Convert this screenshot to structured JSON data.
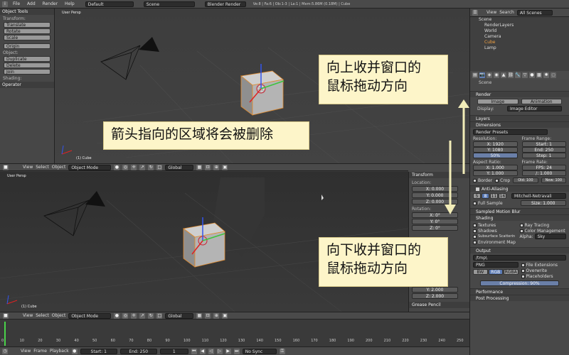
{
  "topbar": {
    "menu": [
      "File",
      "Add",
      "Render",
      "Help"
    ],
    "layout": "Default",
    "scene": "Scene",
    "engine": "Blender Render",
    "stats": "Ve:8 | Fa:6 | Ob:1-3 | La:1 | Mem:5.86M (0.18M) | Cube"
  },
  "toolshelf": {
    "header": "Object Tools",
    "transform_label": "Transform:",
    "transform_buttons": [
      "Translate",
      "Rotate",
      "Scale"
    ],
    "origin_button": "Origin",
    "object_label": "Object:",
    "object_buttons": [
      "Duplicate",
      "Delete",
      "Join"
    ],
    "shading_label": "Shading:",
    "operator_header": "Operator"
  },
  "viewport_top": {
    "label": "User Persp",
    "object_label": "(1) Cube"
  },
  "viewport_header": {
    "menu": [
      "View",
      "Select",
      "Object"
    ],
    "mode": "Object Mode",
    "orientation": "Global"
  },
  "viewport_bottom": {
    "label": "User Persp",
    "object_label": "(1) Cube"
  },
  "npanel": {
    "header": "Transform",
    "location_label": "Location:",
    "location": [
      "X: 0.000",
      "Y: 0.000",
      "Z: 0.000"
    ],
    "rotation_label": "Rotation:",
    "rotation": [
      "X: 0°",
      "Y: 0°",
      "Z: 0°"
    ],
    "dimensions": [
      "Y: 2.000",
      "Z: 2.000"
    ],
    "footer": "Grease Pencil"
  },
  "timeline": {
    "ticks": [
      "0",
      "10",
      "20",
      "30",
      "40",
      "50",
      "60",
      "70",
      "80",
      "90",
      "100",
      "110",
      "120",
      "130",
      "140",
      "150",
      "160",
      "170",
      "180",
      "190",
      "200",
      "210",
      "220",
      "230",
      "240",
      "250"
    ],
    "menu": [
      "View",
      "Frame",
      "Playback"
    ],
    "start": "Start: 1",
    "end": "End: 250",
    "current": "1",
    "sync": "No Sync"
  },
  "outliner": {
    "menu": [
      "View",
      "Search"
    ],
    "filter": "All Scenes",
    "items": [
      "Scene",
      "RenderLayers",
      "World",
      "Camera",
      "Cube",
      "Lamp"
    ]
  },
  "properties": {
    "breadcrumb": "Scene",
    "render_header": "Render",
    "render_buttons": [
      "Image",
      "Animation"
    ],
    "display_label": "Display:",
    "display_value": "Image Editor",
    "layers_header": "Layers",
    "dimensions_header": "Dimensions",
    "presets": "Render Presets",
    "resolution_label": "Resolution:",
    "res_x": "X: 1920",
    "res_y": "Y: 1080",
    "res_pct": "50%",
    "frame_range_label": "Frame Range:",
    "start": "Start: 1",
    "end": "End: 250",
    "step": "Step: 1",
    "aspect_label": "Aspect Ratio:",
    "aspect_x": "X: 1.000",
    "aspect_y": "Y: 1.000",
    "frame_rate_label": "Frame Rate:",
    "fps": "FPS: 24",
    "time": "/: 1.000",
    "border": "Border",
    "crop": "Crop",
    "old": "Old: 100",
    "new": "New: 100",
    "aa_header": "Anti-Aliasing",
    "aa_samples": [
      "5",
      "8",
      "11",
      "16"
    ],
    "aa_filter": "Mitchell-Netravali",
    "full_sample": "Full Sample",
    "size": "Size: 1.000",
    "motion_blur": "Sampled Motion Blur",
    "shading_header": "Shading",
    "shading_left": [
      "Textures",
      "Shadows",
      "Subsurface Scatterin",
      "Environment Map"
    ],
    "shading_right": [
      "Ray Tracing",
      "Color Management"
    ],
    "alpha_label": "Alpha:",
    "alpha_value": "Sky",
    "output_header": "Output",
    "output_path": "/tmp\\",
    "format": "PNG",
    "file_ext": "File Extensions",
    "overwrite": "Overwrite",
    "placeholders": "Placeholders",
    "color_modes": [
      "BW",
      "RGB",
      "RGBA"
    ],
    "compression": "Compression: 90%",
    "performance": "Performance",
    "post_processing": "Post Processing"
  },
  "callouts": {
    "delete_area": "箭头指向的区域将会被删除",
    "drag_up": "向上收并窗口的\n鼠标拖动方向",
    "drag_down": "向下收并窗口的\n鼠标拖动方向"
  },
  "colors": {
    "callout_bg": "#fdf5c9",
    "arrow": "#f1ecb8",
    "selection_outline": "#e08a2d"
  }
}
